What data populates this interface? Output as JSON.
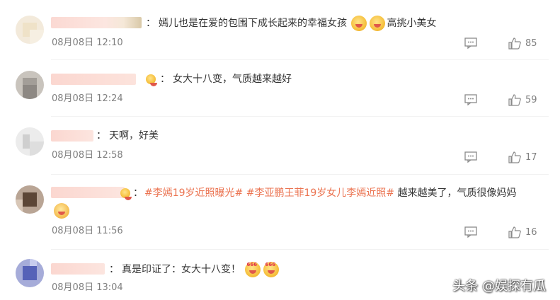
{
  "comments": [
    {
      "text": "嫣儿也是在爱的包围下成长起来的幸福女孩",
      "text_after": "高挑小美女",
      "time": "08月08日 12:10",
      "likes": "85"
    },
    {
      "text": "女大十八变，气质越来越好",
      "time": "08月08日 12:24",
      "likes": "59"
    },
    {
      "text": "天啊，好美",
      "time": "08月08日 12:58",
      "likes": "17"
    },
    {
      "hashtag1": "#李嫣19岁近照曝光#",
      "hashtag2": "#李亚鹏王菲19岁女儿李嫣近照#",
      "text": "越来越美了，气质很像妈妈",
      "time": "08月08日 11:56",
      "likes": "16"
    },
    {
      "text": "真是印证了：女大十八变！",
      "time": "08月08日 13:04",
      "likes": ""
    }
  ],
  "colon": "：",
  "watermark": "头条 @娱探有瓜",
  "colors": {
    "hashtag": "#eb7350",
    "meta": "#808080",
    "text": "#333333"
  },
  "icons": [
    "reply-icon",
    "like-icon",
    "emoji-icon"
  ]
}
